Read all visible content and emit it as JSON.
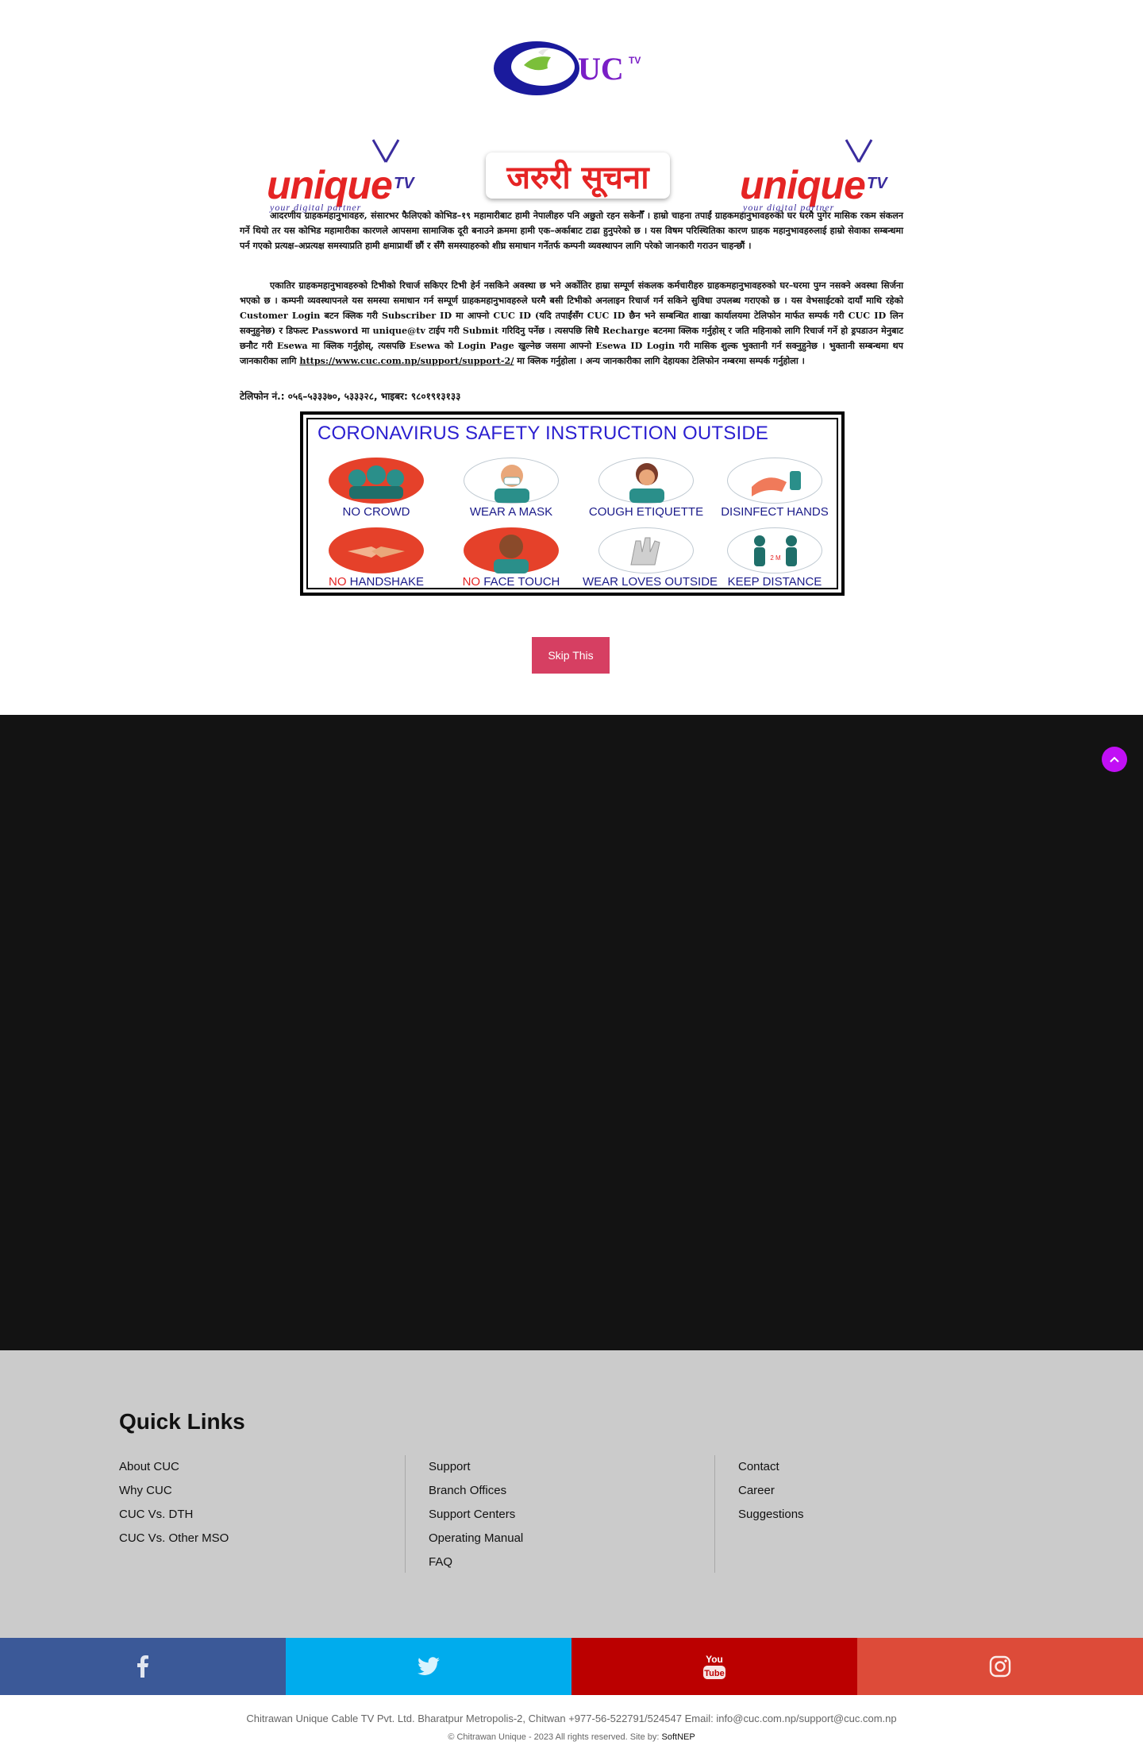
{
  "logo": {
    "text": "UC",
    "sub": "TV"
  },
  "notice": {
    "brand_word": "unique",
    "brand_tv": "TV",
    "brand_tagline": "your digital partner",
    "urgent_title": "जरुरी सूचना",
    "paragraph1": "आदरणीय ग्राहकमहानुभावहरु, संसारभर फैलिएको कोभिड–१९ महामारीबाट हामी नेपालीहरु पनि अछुतो रहन सकेनौँ । हाम्रो चाहना तपाईं ग्राहकमहानुभावहरुको घर घरमै पुगेर मासिक रकम संकलन गर्ने थियो तर यस कोभिड महामारीका कारणले आपसमा सामाजिक दूरी बनाउने क्रममा हामी एक–अर्काबाट टाढा हुनुपरेको छ । यस विषम परिस्थितिका कारण ग्राहक महानुभावहरुलाई हाम्रो सेवाका सम्बन्धमा पर्न गएको प्रत्यक्ष–अप्रत्यक्ष समस्याप्रति हामी क्षमाप्रार्थी छौं र सँगै समस्याहरुको शीघ्र समाधान गर्नेतर्फ कम्पनी व्यवस्थापन लागि परेको जानकारी गराउन चाहन्छौं ।",
    "paragraph2": "एकातिर ग्राहकमहानुभावहरुको टिभीको रिचार्ज सकिएर टिभी हेर्न नसकिने अवस्था छ भने अर्कोतिर हाम्रा सम्पूर्ण संकलक कर्मचारीहरु ग्राहकमहानुभावहरुको घर–घरमा पुग्न नसक्ने अवस्था सिर्जना भएको छ । कम्पनी व्यवस्थापनले यस समस्या समाधान गर्न सम्पूर्ण ग्राहकमहानुभावहरुले घरमै बसी टिभीको अनलाइन रिचार्ज गर्न सकिने सुविधा उपलब्ध गराएको छ । यस वेभसाईटको दायाँ माथि रहेको Customer Login बटन क्लिक गरी Subscriber ID मा आफ्नो CUC ID (यदि तपाईंसँग CUC ID छैन भने सम्बन्धित शाखा कार्यालयमा टेलिफोन मार्फत सम्पर्क गरी CUC ID लिन सक्नुहुनेछ) र डिफल्ट Password मा unique@tv टाईप गरी Submit गरिदिनु पर्नेछ । त्यसपछि सिधै Recharge बटनमा क्लिक गर्नुहोस् र जति महिनाको लागि रिचार्ज गर्ने हो ड्रपडाउन मेनुबाट छनौट गरी Esewa मा क्लिक गर्नुहोस्, त्यसपछि Esewa को Login Page खुल्नेछ जसमा आफ्नो Esewa ID Login गरी मासिक शुल्क भुक्तानी गर्न सक्नुहुनेछ । भुक्तानी सम्बन्धमा थप जानकारीका लागि",
    "link": "https://www.cuc.com.np/support/support-2/",
    "paragraph2_tail": " मा क्लिक गर्नुहोला । अन्य जानकारीका लागि देहायका टेलिफोन नम्बरमा सम्पर्क गर्नुहोला ।",
    "phone": "टेलिफोन नं.: ०५६–५३३३७०, ५३३३२८,  भाइबर: ९८०१९१३१३३"
  },
  "safety": {
    "title": "CORONAVIRUS SAFETY INSTRUCTION OUTSIDE",
    "items": [
      {
        "prefix": "",
        "label": "NO CROWD"
      },
      {
        "prefix": "",
        "label": "WEAR A MASK"
      },
      {
        "prefix": "",
        "label": "COUGH ETIQUETTE"
      },
      {
        "prefix": "",
        "label": "DISINFECT HANDS"
      },
      {
        "prefix": "NO",
        "label": " HANDSHAKE"
      },
      {
        "prefix": "NO",
        "label": " FACE TOUCH"
      },
      {
        "prefix": "",
        "label": "WEAR LOVES OUTSIDE"
      },
      {
        "prefix": "",
        "label": "KEEP DISTANCE"
      }
    ],
    "distance_note": "2 M"
  },
  "skip_label": "Skip This",
  "back_to_top": "^",
  "quick_links": {
    "title": "Quick Links",
    "col1": [
      "About CUC",
      "Why CUC",
      "CUC Vs. DTH",
      "CUC Vs. Other MSO"
    ],
    "col2": [
      "Support",
      "Branch Offices",
      "Support Centers",
      "Operating Manual",
      "FAQ"
    ],
    "col3": [
      "Contact",
      "Career",
      "Suggestions"
    ]
  },
  "social": {
    "youtube_text1": "You",
    "youtube_text2": "Tube"
  },
  "colors": {
    "facebook": "#3b5998",
    "twitter": "#00aced",
    "youtube": "#bb0000",
    "instagram": "#dd4b39",
    "skip": "#d63f62",
    "to_top": "#c10ff5"
  },
  "footer": {
    "address": "Chitrawan Unique Cable TV Pvt. Ltd. Bharatpur Metropolis-2, Chitwan +977-56-522791/524547 Email: info@cuc.com.np/support@cuc.com.np",
    "copyright": "© Chitrawan Unique - 2023 All rights reserved. Site by: ",
    "site_by": "SoftNEP"
  }
}
